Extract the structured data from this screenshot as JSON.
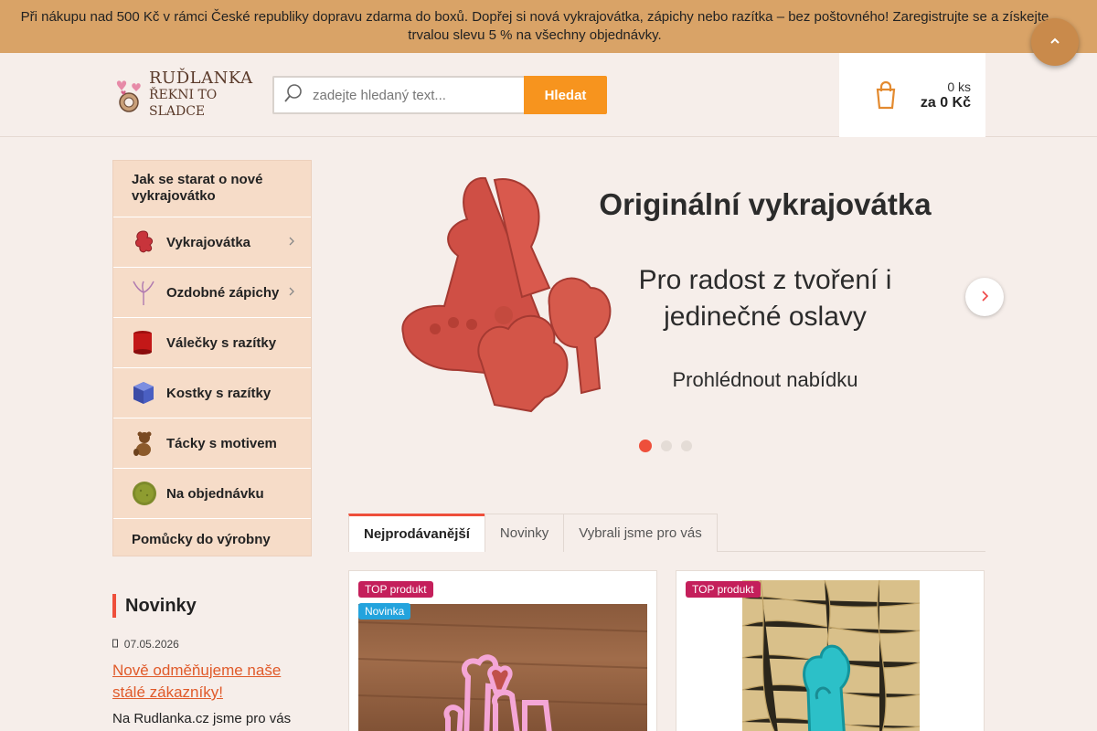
{
  "promo": {
    "text": "Při nákupu nad 500 Kč v rámci České republiky dopravu zdarma do boxů. Dopřej si nová vykrajovátka, zápichy nebo razítka – bez poštovného! Zaregistrujte se a získejte trvalou slevu 5 % na všechny objednávky.",
    "toggle_icon": "chevron-icon"
  },
  "header": {
    "logo_title": "RUĎLANKA",
    "logo_sub": "ŘEKNI TO SLADCE",
    "search_placeholder": "zadejte hledaný text...",
    "search_button": "Hledat",
    "cart_count": "0 ks",
    "cart_price": "za 0 Kč",
    "cart_icon": "cart-icon"
  },
  "sidebar": {
    "items": [
      {
        "label": "Jak se starat o nové vykrajovátko"
      },
      {
        "label": "Vykrajovátka",
        "icon": "cookie-cutter-icon",
        "has_sub": true
      },
      {
        "label": "Ozdobné zápichy",
        "icon": "pick-icon",
        "has_sub": true
      },
      {
        "label": "Válečky s razítky",
        "icon": "roller-icon"
      },
      {
        "label": "Kostky s razítky",
        "icon": "cube-icon"
      },
      {
        "label": "Tácky s motivem",
        "icon": "coaster-icon"
      },
      {
        "label": "Na objednávku",
        "icon": "custom-order-icon"
      },
      {
        "label": "Pomůcky do výrobny"
      }
    ]
  },
  "slider": {
    "title": "Originální vykrajovátka",
    "subtitle": "Pro radost z tvoření i jedinečné oslavy",
    "cta": "Prohlédnout nabídku",
    "active_dot": 1,
    "dot_count": 3
  },
  "tabs": [
    {
      "label": "Nejprodávanější",
      "active": true
    },
    {
      "label": "Novinky",
      "active": false
    },
    {
      "label": "Vybrali jsme pro vás",
      "active": false
    }
  ],
  "products": [
    {
      "badges": [
        "TOP produkt",
        "Novinka"
      ]
    },
    {
      "badges": [
        "TOP produkt"
      ]
    }
  ],
  "news": {
    "heading": "Novinky",
    "date": "07.05.2026",
    "link": "Nově odměňujeme naše stálé zákazníky!",
    "text": "Na Rudlanka.cz jsme pro vás"
  },
  "colors": {
    "promo_bg": "#d9a367",
    "accent": "#f7941e",
    "sidebar_bg": "#f6dcc8",
    "badge_top": "#c41f5b",
    "badge_new": "#23a3dd",
    "link": "#e05a2a"
  }
}
